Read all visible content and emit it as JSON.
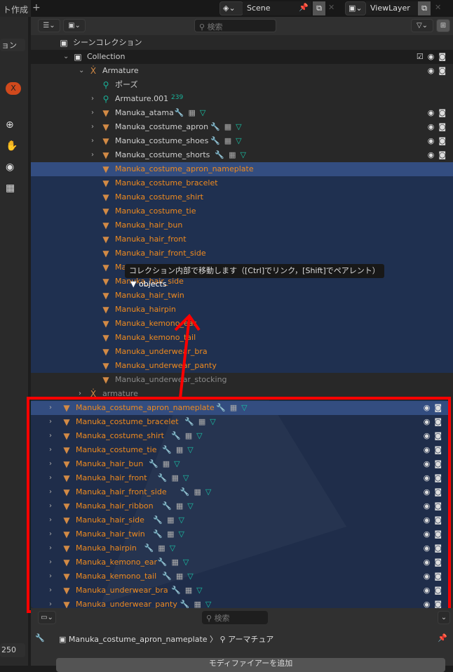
{
  "top": {
    "workspace_tab": "ト作成",
    "add_tab": "+",
    "scene": "Scene",
    "view_layer": "ViewLayer"
  },
  "left": {
    "dropdown": "ョン",
    "frame_end": "250"
  },
  "outliner": {
    "search_placeholder": "検索",
    "upper_rows": [
      {
        "name": "シーンコレクション",
        "depth": 0,
        "icon": "scene-collection",
        "expand": "",
        "state": ""
      },
      {
        "name": "Collection",
        "depth": 1,
        "icon": "collection",
        "expand": "v",
        "state": "",
        "checkbox": true,
        "vis": true
      },
      {
        "name": "Armature",
        "depth": 2,
        "icon": "armature",
        "expand": "v",
        "state": "",
        "vis": true
      },
      {
        "name": "ポーズ",
        "depth": 3,
        "icon": "pose",
        "expand": "",
        "state": ""
      },
      {
        "name": "Armature.001",
        "depth": 3,
        "icon": "pose",
        "expand": ">",
        "state": "",
        "badge": "239"
      },
      {
        "name": "Manuka_atama",
        "depth": 3,
        "icon": "mesh",
        "expand": ">",
        "state": "",
        "mods": true,
        "vis": true
      },
      {
        "name": "Manuka_costume_apron",
        "depth": 3,
        "icon": "mesh",
        "expand": ">",
        "state": "",
        "mods": true,
        "vis": true
      },
      {
        "name": "Manuka_costume_shoes",
        "depth": 3,
        "icon": "mesh",
        "expand": ">",
        "state": "",
        "mods": true,
        "vis": true
      },
      {
        "name": "Manuka_costume_shorts",
        "depth": 3,
        "icon": "mesh",
        "expand": ">",
        "state": "",
        "mods": true,
        "vis": true
      },
      {
        "name": "Manuka_costume_apron_nameplate",
        "depth": 3,
        "icon": "mesh",
        "expand": "",
        "state": "active"
      },
      {
        "name": "Manuka_costume_bracelet",
        "depth": 3,
        "icon": "mesh",
        "expand": "",
        "state": "sel"
      },
      {
        "name": "Manuka_costume_shirt",
        "depth": 3,
        "icon": "mesh",
        "expand": "",
        "state": "sel"
      },
      {
        "name": "Manuka_costume_tie",
        "depth": 3,
        "icon": "mesh",
        "expand": "",
        "state": "sel"
      },
      {
        "name": "Manuka_hair_bun",
        "depth": 3,
        "icon": "mesh",
        "expand": "",
        "state": "sel"
      },
      {
        "name": "Manuka_hair_front",
        "depth": 3,
        "icon": "mesh",
        "expand": "",
        "state": "sel"
      },
      {
        "name": "Manuka_hair_front_side",
        "depth": 3,
        "icon": "mesh",
        "expand": "",
        "state": "sel"
      },
      {
        "name": "Manuka_hair_ribbon",
        "depth": 3,
        "icon": "mesh",
        "expand": "",
        "state": "sel"
      },
      {
        "name": "Manuka_hair_side",
        "depth": 3,
        "icon": "mesh",
        "expand": "",
        "state": "sel"
      },
      {
        "name": "Manuka_hair_twin",
        "depth": 3,
        "icon": "mesh",
        "expand": "",
        "state": "sel"
      },
      {
        "name": "Manuka_hairpin",
        "depth": 3,
        "icon": "mesh",
        "expand": "",
        "state": "sel"
      },
      {
        "name": "Manuka_kemono_ear",
        "depth": 3,
        "icon": "mesh",
        "expand": "",
        "state": "sel"
      },
      {
        "name": "Manuka_kemono_tail",
        "depth": 3,
        "icon": "mesh",
        "expand": "",
        "state": "sel"
      },
      {
        "name": "Manuka_underwear_bra",
        "depth": 3,
        "icon": "mesh",
        "expand": "",
        "state": "sel"
      },
      {
        "name": "Manuka_underwear_panty",
        "depth": 3,
        "icon": "mesh",
        "expand": "",
        "state": "sel"
      },
      {
        "name": "Manuka_underwear_stocking",
        "depth": 3,
        "icon": "mesh",
        "expand": "",
        "state": "dim"
      },
      {
        "name": "armature",
        "depth": 2,
        "icon": "armature",
        "expand": ">",
        "state": "dim"
      }
    ],
    "lower_rows": [
      "Manuka_costume_apron_nameplate",
      "Manuka_costume_bracelet",
      "Manuka_costume_shirt",
      "Manuka_costume_tie",
      "Manuka_hair_bun",
      "Manuka_hair_front",
      "Manuka_hair_front_side",
      "Manuka_hair_ribbon",
      "Manuka_hair_side",
      "Manuka_hair_twin",
      "Manuka_hairpin",
      "Manuka_kemono_ear",
      "Manuka_kemono_tail",
      "Manuka_underwear_bra",
      "Manuka_underwear_panty"
    ],
    "tooltip": "コレクション内部で移動します（[Ctrl]でリンク，[Shift]でペアレント）",
    "drag_label": "objects"
  },
  "properties": {
    "search_placeholder": "検索",
    "object": "Manuka_costume_apron_nameplate",
    "data": "アーマチュア",
    "add_modifier": "モディファイアーを追加"
  },
  "colors": {
    "selected": "#1f3050",
    "active": "#334d80",
    "object_text": "#ef8a1e",
    "annotation": "#ff0000"
  }
}
